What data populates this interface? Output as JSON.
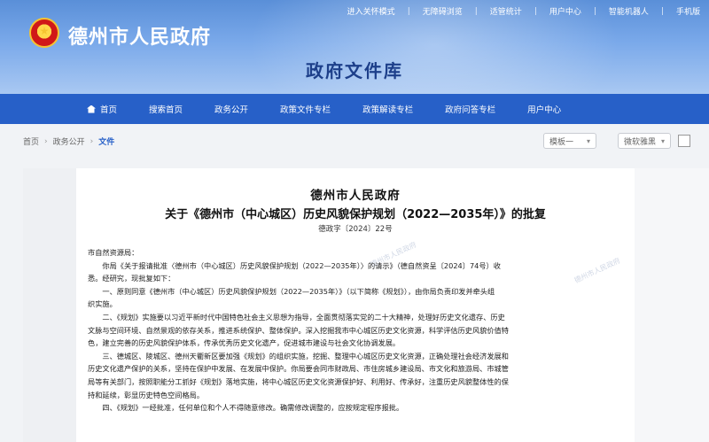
{
  "topbar": {
    "items": [
      "进入关怀模式",
      "无障碍浏览",
      "适管统计",
      "用户中心",
      "智能机器人",
      "手机版"
    ]
  },
  "header": {
    "site_title": "德州市人民政府",
    "section_title": "政府文件库"
  },
  "nav": {
    "items": [
      "首页",
      "搜索首页",
      "政务公开",
      "政策文件专栏",
      "政策解读专栏",
      "政府问答专栏",
      "用户中心"
    ]
  },
  "breadcrumb": [
    "首页",
    "政务公开",
    "文件"
  ],
  "toolbar": {
    "template_select": "模板一",
    "search_select": "微软雅黑"
  },
  "document": {
    "org": "德州市人民政府",
    "title": "关于《德州市（中心城区）历史风貌保护规划（2022—2035年）》的批复",
    "number": "德政字〔2024〕22号",
    "watermark": "德州市人民政府",
    "lines": [
      {
        "indent": false,
        "text": "市自然资源局："
      },
      {
        "indent": true,
        "text": "你局《关于报请批准〈德州市（中心城区）历史风貌保护规划（2022—2035年）〉的请示》（德自然资呈〔2024〕74号）收"
      },
      {
        "indent": false,
        "text": "悉。经研究，现批复如下："
      },
      {
        "indent": true,
        "text": "一、原则同意《德州市（中心城区）历史风貌保护规划（2022—2035年）》（以下简称《规划》），由你局负责印发并牵头组"
      },
      {
        "indent": false,
        "text": "织实施。"
      },
      {
        "indent": true,
        "text": "二、《规划》实施要以习近平新时代中国特色社会主义思想为指导，全面贯彻落实党的二十大精神，处理好历史文化遗存、历史"
      },
      {
        "indent": false,
        "text": "文脉与空间环境、自然景观的依存关系，推进系统保护、整体保护。深入挖掘我市中心城区历史文化资源，科学评估历史风貌价值特"
      },
      {
        "indent": false,
        "text": "色，建立完善的历史风貌保护体系，传承优秀历史文化遗产，促进城市建设与社会文化协调发展。"
      },
      {
        "indent": true,
        "text": "三、德城区、陵城区、德州天衢新区要加强《规划》的组织实施，挖掘、整理中心城区历史文化资源，正确处理社会经济发展和"
      },
      {
        "indent": false,
        "text": "历史文化遗产保护的关系，坚持在保护中发展、在发展中保护。你局要会同市财政局、市住房城乡建设局、市文化和旅游局、市城管"
      },
      {
        "indent": false,
        "text": "局等有关部门，按照职能分工抓好《规划》落地实施，将中心城区历史文化资源保护好、利用好、传承好，注重历史风貌整体性的保"
      },
      {
        "indent": false,
        "text": "持和延续，彰显历史特色空间格局。"
      },
      {
        "indent": true,
        "text": "四、《规划》一经批准，任何单位和个人不得随意修改。确需修改调整的，应按规定程序报批。"
      }
    ]
  }
}
